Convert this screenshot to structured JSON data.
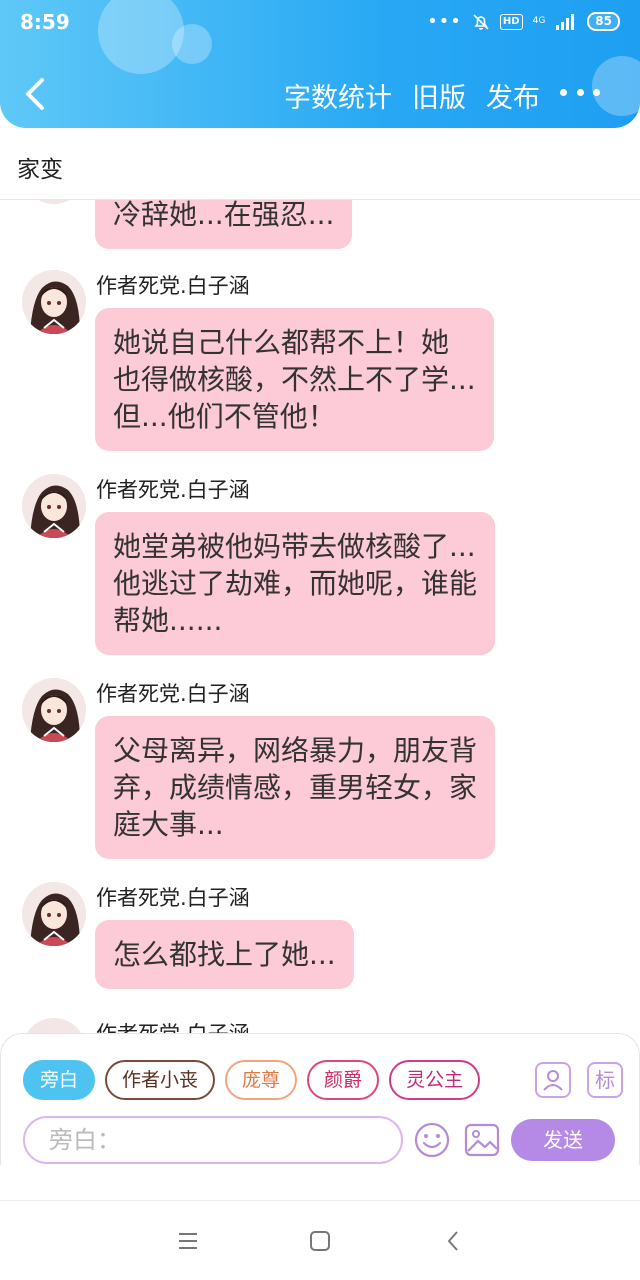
{
  "status_bar": {
    "time": "8:59",
    "network": "4G",
    "hd": "HD",
    "battery": "85"
  },
  "header": {
    "word_count": "字数统计",
    "old_version": "旧版",
    "publish": "发布",
    "accent_color": "#28a8f4"
  },
  "document": {
    "title": "家变"
  },
  "messages": [
    {
      "author": "",
      "lines": [
        "冷辞她...在强忍..."
      ]
    },
    {
      "author": "作者死党.白子涵",
      "lines": [
        "她说自己什么都帮不上！她",
        "也得做核酸，不然上不了学...",
        "但...他们不管他！"
      ]
    },
    {
      "author": "作者死党.白子涵",
      "lines": [
        "她堂弟被他妈带去做核酸了...",
        "他逃过了劫难，而她呢，谁能",
        "帮她......"
      ]
    },
    {
      "author": "作者死党.白子涵",
      "lines": [
        "父母离异，网络暴力，朋友背",
        "弃，成绩情感，重男轻女，家",
        "庭大事..."
      ]
    },
    {
      "author": "作者死党.白子涵",
      "lines": [
        "怎么都找上了她..."
      ]
    },
    {
      "author": "作者死党.白子涵",
      "lines": []
    }
  ],
  "bubble_color": "#fdcad7",
  "input_panel": {
    "roles": [
      "旁白",
      "作者小丧",
      "庞尊",
      "颜爵",
      "灵公主"
    ],
    "role_icon_label": "标",
    "input_placeholder": "旁白：",
    "send_label": "发送"
  },
  "icons": {
    "back": "chevron-left-icon",
    "more": "more-dots-icon",
    "emoji": "emoji-icon",
    "image": "image-icon",
    "role_manage": "role-person-icon",
    "menu": "menu-icon",
    "home": "home-square-icon",
    "system_back": "back-triangle-icon"
  }
}
